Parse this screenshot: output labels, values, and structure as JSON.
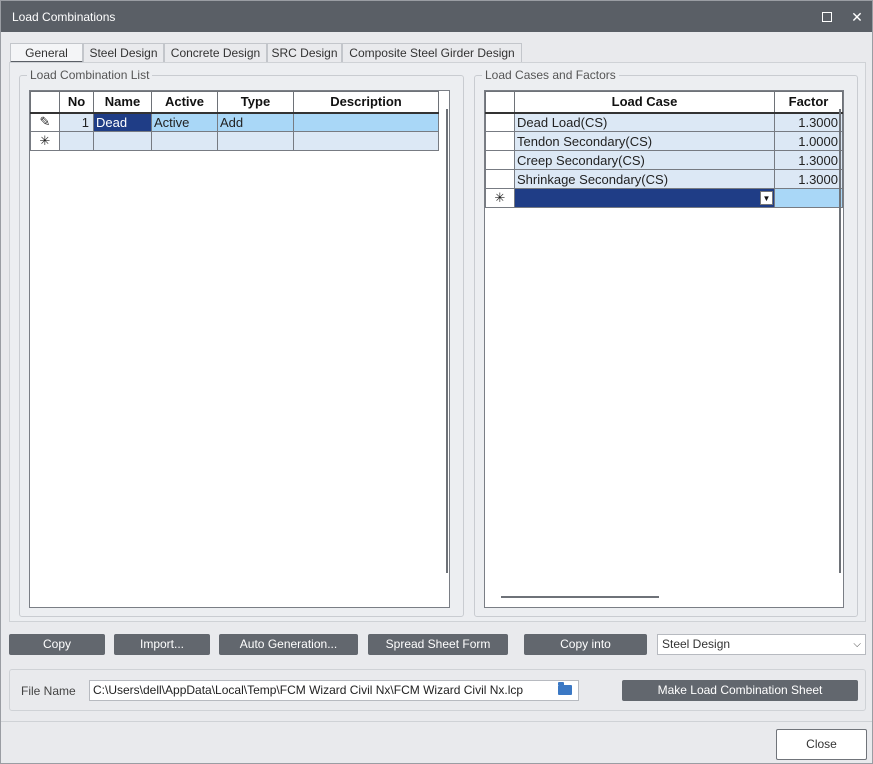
{
  "window": {
    "title": "Load Combinations"
  },
  "tabs": [
    {
      "label": "General",
      "active": true
    },
    {
      "label": "Steel Design",
      "active": false
    },
    {
      "label": "Concrete Design",
      "active": false
    },
    {
      "label": "SRC Design",
      "active": false
    },
    {
      "label": "Composite Steel Girder Design",
      "active": false
    }
  ],
  "left_group": {
    "label": "Load Combination List",
    "columns": [
      "No",
      "Name",
      "Active",
      "Type",
      "Description"
    ],
    "rows": [
      {
        "marker": "✎",
        "no": "1",
        "name": "Dead",
        "active": "Active",
        "type": "Add",
        "description": ""
      },
      {
        "marker": "✳",
        "no": "",
        "name": "",
        "active": "",
        "type": "",
        "description": ""
      }
    ]
  },
  "right_group": {
    "label": "Load Cases and Factors",
    "columns": [
      "Load Case",
      "Factor"
    ],
    "rows": [
      {
        "marker": "",
        "load_case": "Dead Load(CS)",
        "factor": "1.3000"
      },
      {
        "marker": "",
        "load_case": "Tendon Secondary(CS)",
        "factor": "1.0000"
      },
      {
        "marker": "",
        "load_case": "Creep Secondary(CS)",
        "factor": "1.3000"
      },
      {
        "marker": "",
        "load_case": "Shrinkage Secondary(CS)",
        "factor": "1.3000"
      },
      {
        "marker": "✳",
        "load_case": "",
        "factor": ""
      }
    ]
  },
  "buttons": {
    "copy": "Copy",
    "import": "Import...",
    "auto_generation": "Auto Generation...",
    "spread_sheet": "Spread Sheet Form",
    "copy_into": "Copy into",
    "make_sheet": "Make Load Combination Sheet",
    "close": "Close"
  },
  "copy_into_select": {
    "value": "Steel Design"
  },
  "file": {
    "label": "File Name",
    "path": "C:\\Users\\dell\\AppData\\Local\\Temp\\FCM Wizard Civil Nx\\FCM Wizard Civil Nx.lcp"
  }
}
